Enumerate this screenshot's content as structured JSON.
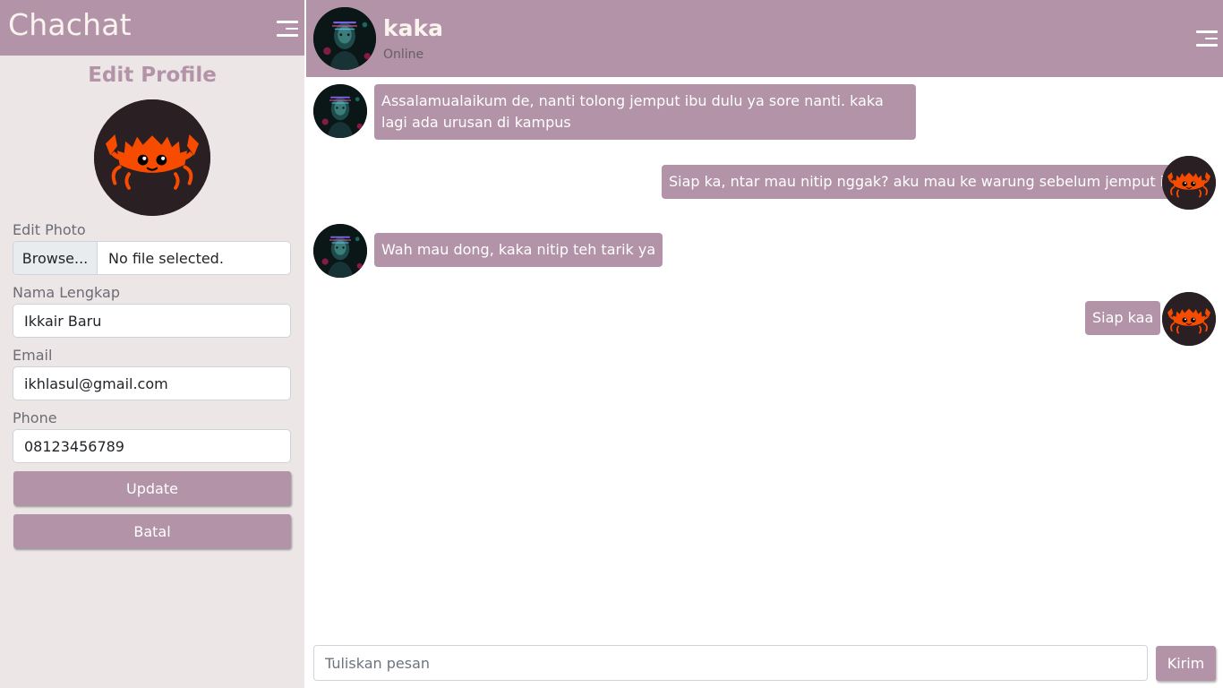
{
  "app": {
    "title": "Chachat"
  },
  "sidebar": {
    "menu_icon": "hamburger-menu-icon",
    "edit_profile": {
      "title": "Edit Profile",
      "avatar_icon": "crab-avatar",
      "photo": {
        "label": "Edit Photo",
        "browse_label": "Browse...",
        "status": "No file selected."
      },
      "full_name": {
        "label": "Nama Lengkap",
        "value": "Ikkair Baru"
      },
      "email": {
        "label": "Email",
        "value": "ikhlasul@gmail.com"
      },
      "phone": {
        "label": "Phone",
        "value": "08123456789"
      },
      "update_label": "Update",
      "cancel_label": "Batal"
    }
  },
  "chat": {
    "contact": {
      "name": "kaka",
      "status": "Online"
    },
    "menu_icon": "hamburger-menu-icon",
    "messages": [
      {
        "side": "left",
        "text": "Assalamualaikum de, nanti tolong jemput ibu dulu ya sore nanti. kaka lagi ada urusan di kampus"
      },
      {
        "side": "right",
        "text": "Siap ka, ntar mau nitip nggak? aku mau ke warung sebelum jemput ibu"
      },
      {
        "side": "left",
        "text": "Wah mau dong, kaka nitip teh tarik ya"
      },
      {
        "side": "right",
        "text": "Siap kaa"
      }
    ],
    "composer": {
      "placeholder": "Tuliskan pesan",
      "send_label": "Kirim"
    }
  },
  "colors": {
    "accent": "#b293a8",
    "sidebar_bg": "#ede6e6",
    "title_text": "#fbf4ee",
    "crab": "#f74c00"
  }
}
